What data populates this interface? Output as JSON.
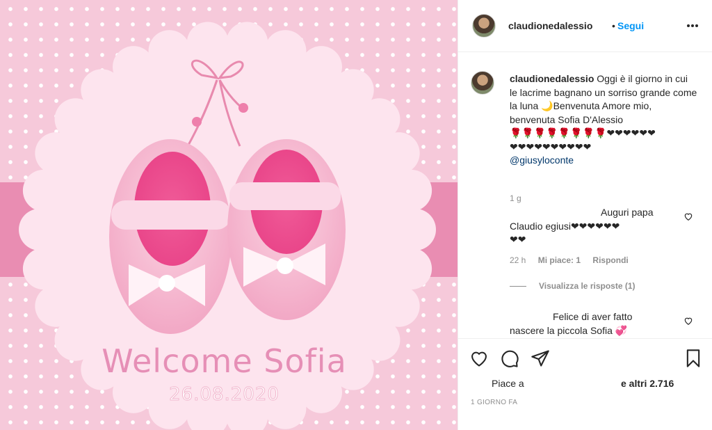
{
  "colors": {
    "background_pink": "#f6c9da",
    "ribbon_pink": "#e98db2",
    "medallion": "#fde4ee",
    "link_blue": "#0095f6",
    "text_gray": "#8e8e8e"
  },
  "image": {
    "welcome_text": "Welcome Sofia",
    "date_text": "26.08.2020"
  },
  "header": {
    "username": "claudionedalessio",
    "dot": "•",
    "follow_label": "Segui",
    "more_icon": "ellipsis-icon"
  },
  "caption": {
    "username": "claudionedalessio",
    "text": " Oggi è il giorno in cui le lacrime bagnano un sorriso grande come la luna 🌙Benvenuta Amore mio, benvenuta Sofia D'Alessio",
    "emoji_row_1": "🌹🌹🌹🌹🌹🌹🌹🌹❤❤❤❤❤❤",
    "emoji_row_2": "❤❤❤❤❤❤❤❤❤❤",
    "mention": "@giusyloconte",
    "time": "1 g"
  },
  "comments": [
    {
      "line1": "Auguri papa",
      "line2": "Claudio egiusi❤❤❤❤❤❤",
      "line3": "❤❤",
      "time": "22 h",
      "likes": "Mi piace: 1",
      "reply": "Rispondi",
      "view_replies": "Visualizza le risposte (1)"
    },
    {
      "line1": "Felice di aver fatto",
      "line2": "nascere la piccola Sofia 💞"
    }
  ],
  "actions": {
    "like_icon": "heart-icon",
    "comment_icon": "comment-icon",
    "share_icon": "share-icon",
    "save_icon": "bookmark-icon",
    "likes_prefix": "Piace a",
    "likes_suffix": "e altri 2.716",
    "date": "1 GIORNO FA"
  }
}
